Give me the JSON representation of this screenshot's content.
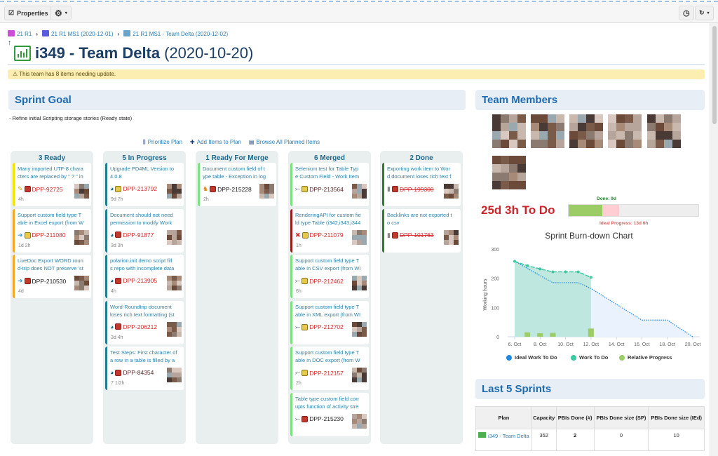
{
  "toolbar": {
    "properties_label": "Properties",
    "settings_icon": "gear-icon",
    "history_icon": "clock-icon",
    "refresh_icon": "refresh-icon"
  },
  "breadcrumb": [
    {
      "label": "21 R1",
      "color": "#c94fd6"
    },
    {
      "label": "21 R1 MS1 (2020-12-01)",
      "color": "#5a5ae0"
    },
    {
      "label": "21 R1 MS1 - Team Delta (2020-12-02)",
      "color": "#6aa3c7"
    }
  ],
  "page": {
    "title_id": "i349 - Team Delta",
    "title_date": "(2020-10-20)",
    "warning": "This team has 8 items needing update."
  },
  "sprint_goal": {
    "heading": "Sprint Goal",
    "text": "- Refine initial Scripting storage stories (Ready state)"
  },
  "actions": [
    {
      "label": "Prioritize Plan",
      "icon": "prioritize-icon"
    },
    {
      "label": "Add Items to Plan",
      "icon": "plus-icon"
    },
    {
      "label": "Browse All Planned Items",
      "icon": "browse-icon"
    }
  ],
  "board": [
    {
      "title": "3 Ready",
      "cards": [
        {
          "title": [
            "Many imported UTF-8 chara",
            "cters are replaced by \" ? \" in"
          ],
          "id": "DPP-92725",
          "id_color": "#d42a2a",
          "type_icon": "pencil-icon",
          "status_icon": "red-badge",
          "time": "4h",
          "bar": "#f2e300",
          "strike": false
        },
        {
          "title": [
            "Support custom field type T",
            "able in Excel export (from W"
          ],
          "id": "DPP-211080",
          "id_color": "#d42a2a",
          "type_icon": "user-story-icon",
          "status_icon": "yellow-badge",
          "time": "1d 2h",
          "bar": "#f5a623",
          "strike": false
        },
        {
          "title": [
            "LiveDoc Export WORD roun",
            "d-trip does NOT preserve 'st"
          ],
          "id": "DPP-210530",
          "id_color": "#222222",
          "type_icon": "user-story-icon",
          "status_icon": "red-badge",
          "time": "4d",
          "bar": "#f5a623",
          "strike": false
        }
      ]
    },
    {
      "title": "5 In Progress",
      "cards": [
        {
          "title": [
            "Upgrade PD4ML Version to",
            "4.0.8"
          ],
          "id": "DPP-213792",
          "id_color": "#d42a2a",
          "type_icon": "in-progress-icon",
          "status_icon": "yellow-badge",
          "time": "9d 7h",
          "bar": "#1f7f8f",
          "strike": false
        },
        {
          "title": [
            "Document should not need",
            "permission to modify Work"
          ],
          "id": "DPP-91877",
          "id_color": "#d42a2a",
          "type_icon": "in-progress-icon",
          "status_icon": "red-badge",
          "time": "3d 3h",
          "bar": "#1f7f8f",
          "strike": false
        },
        {
          "title": [
            "polarion.init demo script fill",
            "s repo with incomplete data"
          ],
          "id": "DPP-213905",
          "id_color": "#d42a2a",
          "type_icon": "in-progress-icon",
          "status_icon": "red-badge",
          "time": "4h",
          "bar": "#1f7f8f",
          "strike": false
        },
        {
          "title": [
            "Word-Roundtrip document",
            "loses rich text formatting (st"
          ],
          "id": "DPP-206212",
          "id_color": "#d42a2a",
          "type_icon": "in-progress-icon",
          "status_icon": "red-badge",
          "time": "3d 4h",
          "bar": "#1f7f8f",
          "strike": false
        },
        {
          "title": [
            "Test Steps: First character of",
            "a row in a table is filled by a"
          ],
          "id": "DPP-84354",
          "id_color": "#5a2a2a",
          "type_icon": "in-progress-icon",
          "status_icon": "red-badge",
          "time": "7 1/2h",
          "bar": "#1f7f8f",
          "strike": false
        }
      ]
    },
    {
      "title": "1 Ready For Merge",
      "cards": [
        {
          "title": [
            "Document custom field of t",
            "ype table - Exception in log"
          ],
          "id": "DPP-215228",
          "id_color": "#222222",
          "type_icon": "ready-merge-icon",
          "status_icon": "red-badge",
          "time": "2h",
          "bar": "#7ee07e",
          "strike": false
        }
      ]
    },
    {
      "title": "6 Merged",
      "cards": [
        {
          "title": [
            "Selenium test for Table Typ",
            "e Custom Field - Work Item"
          ],
          "id": "DPP-213564",
          "id_color": "#5a2a2a",
          "type_icon": "merge-icon",
          "status_icon": "yellow-badge",
          "time": "",
          "bar": "#7ee07e",
          "strike": false
        },
        {
          "title": [
            "RenderingAPI for custom fie",
            "ld type Table (i342,i343,i344"
          ],
          "id": "DPP-211079",
          "id_color": "#d42a2a",
          "type_icon": "x-icon",
          "status_icon": "yellow-badge",
          "time": "1h",
          "bar": "#9b1c1c",
          "strike": false
        },
        {
          "title": [
            "Support custom field type T",
            "able in CSV export (from WI"
          ],
          "id": "DPP-212462",
          "id_color": "#d42a2a",
          "type_icon": "merge-icon",
          "status_icon": "yellow-badge",
          "time": "6h",
          "bar": "#7ee07e",
          "strike": false
        },
        {
          "title": [
            "Support custom field type T",
            "able in XML export (from WI"
          ],
          "id": "DPP-212702",
          "id_color": "#d42a2a",
          "type_icon": "merge-icon",
          "status_icon": "yellow-badge",
          "time": "",
          "bar": "#7ee07e",
          "strike": false
        },
        {
          "title": [
            "Support custom field type T",
            "able in DOC export (from W"
          ],
          "id": "DPP-212157",
          "id_color": "#d42a2a",
          "type_icon": "merge-icon",
          "status_icon": "yellow-badge",
          "time": "2h",
          "bar": "#7ee07e",
          "strike": false
        },
        {
          "title": [
            "Table type custom field corr",
            "upts function of activity stre"
          ],
          "id": "DPP-215230",
          "id_color": "#222222",
          "type_icon": "merge-icon",
          "status_icon": "red-badge",
          "time": "",
          "bar": "#7ee07e",
          "strike": false
        }
      ]
    },
    {
      "title": "2 Done",
      "cards": [
        {
          "title": [
            "Exporting work item to Wor",
            "d document loses rich text f"
          ],
          "id": "DPP-199300",
          "id_color": "#d42a2a",
          "type_icon": "microphone-icon",
          "status_icon": "red-badge",
          "time": "",
          "bar": "#2e7d32",
          "strike": true
        },
        {
          "title": [
            "Backlinks are not exported t",
            "o csv"
          ],
          "id": "DPP-101763",
          "id_color": "#d42a2a",
          "type_icon": "microphone-icon",
          "status_icon": "red-badge",
          "time": "",
          "bar": "#2e7d32",
          "strike": true
        }
      ]
    }
  ],
  "team": {
    "heading": "Team Members"
  },
  "progress": {
    "todo": "25d 3h To Do",
    "done_label": "Done: 9d",
    "ideal_label": "Ideal Progress: 13d 6h",
    "done_fraction": 0.26,
    "ideal_fraction": 0.39,
    "done_color": "#9ccc65",
    "ideal_color": "#ffcdd2"
  },
  "chart_data": {
    "type": "line",
    "title": "Sprint Burn-down Chart",
    "ylabel": "Working hours",
    "ylim": [
      0,
      300
    ],
    "yticks": [
      0,
      100,
      200,
      300
    ],
    "xticks": [
      "6. Oct",
      "8. Oct",
      "10. Oct",
      "12. Oct",
      "14. Oct",
      "16. Oct",
      "18. Oct",
      "20. Oct"
    ],
    "series": [
      {
        "name": "Ideal Work To Do",
        "color": "#1e88e5",
        "points": [
          [
            "6. Oct",
            258
          ],
          [
            "9. Oct",
            185
          ],
          [
            "11. Oct",
            185
          ],
          [
            "12. Oct",
            165
          ],
          [
            "16. Oct",
            57
          ],
          [
            "18. Oct",
            57
          ],
          [
            "20. Oct",
            0
          ]
        ]
      },
      {
        "name": "Work To Do",
        "color": "#3cc8a0",
        "points": [
          [
            "6. Oct",
            258
          ],
          [
            "7. Oct",
            243
          ],
          [
            "8. Oct",
            232
          ],
          [
            "9. Oct",
            222
          ],
          [
            "10. Oct",
            222
          ],
          [
            "11. Oct",
            222
          ],
          [
            "12. Oct",
            203
          ]
        ]
      },
      {
        "name": "Relative Progress",
        "color": "#9ccc65",
        "type": "bar",
        "points": [
          [
            "7. Oct",
            15
          ],
          [
            "8. Oct",
            12
          ],
          [
            "9. Oct",
            13
          ],
          [
            "12. Oct",
            28
          ]
        ]
      }
    ]
  },
  "sprints": {
    "heading": "Last 5 Sprints",
    "columns": [
      "Plan",
      "Capacity",
      "PBIs Done (#)",
      "PBIs Done size (SP)",
      "PBIs Done size (IEd)"
    ],
    "rows": [
      {
        "plan": "i349 - Team Delta",
        "capacity": "352",
        "done": "2",
        "sp": "0",
        "ied": "10"
      }
    ]
  }
}
